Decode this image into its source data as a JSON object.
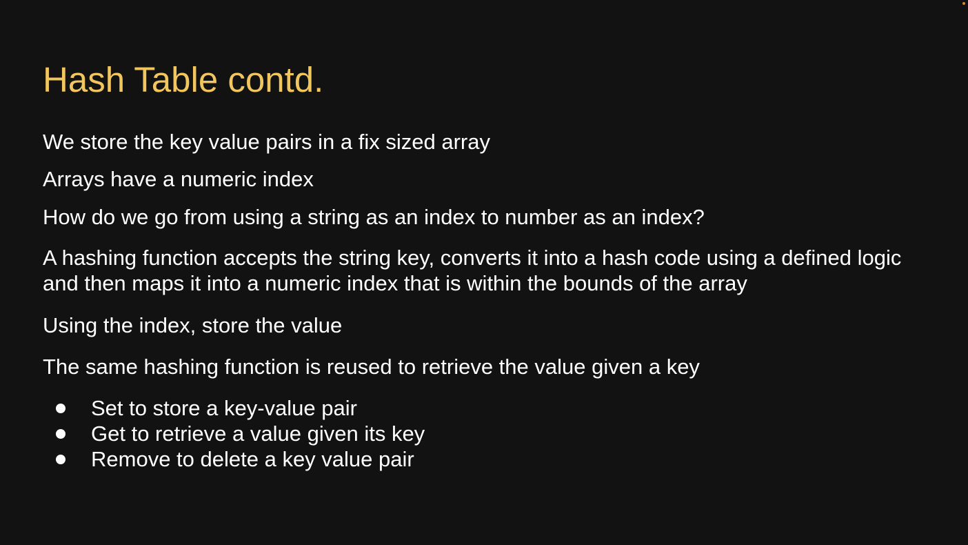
{
  "slide": {
    "title": "Hash Table contd.",
    "paragraphs": [
      "We store the key value pairs in a fix sized array",
      "Arrays have a numeric index",
      "How do we go from using a string as an index to number as an index?",
      "A hashing function accepts the string key, converts it into a hash code using a defined logic and then maps it into a numeric index that is within the bounds of the array",
      "Using the index, store the value",
      "The same hashing function is reused to retrieve the value given a key"
    ],
    "bullets": [
      "Set to store a key-value pair",
      "Get to retrieve a value given its key",
      "Remove to delete a key value pair"
    ]
  },
  "colors": {
    "background": "#121212",
    "title": "#f1c65e",
    "text": "#ffffff",
    "corner_indicator": "#e0852e"
  }
}
